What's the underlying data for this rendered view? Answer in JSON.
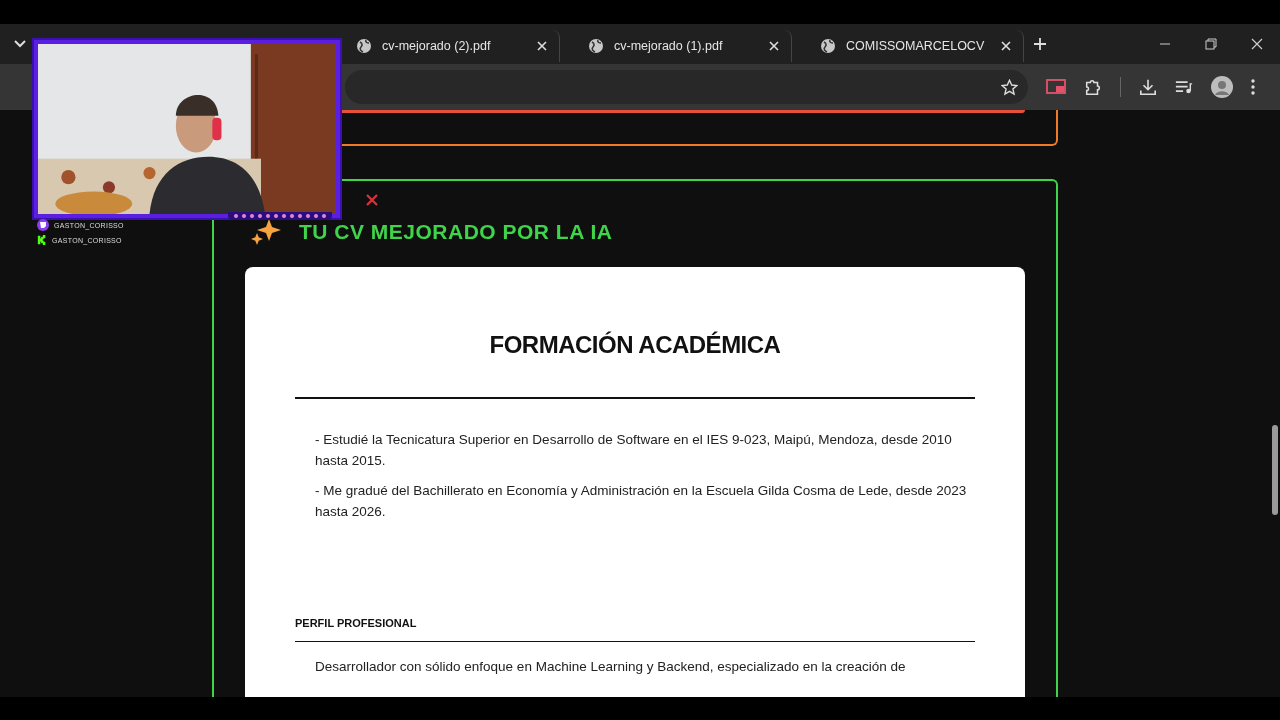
{
  "browser": {
    "tabs": [
      {
        "title": "cv-mejorado (2).pdf",
        "selected": false
      },
      {
        "title": "cv-mejorado (1).pdf",
        "selected": false
      },
      {
        "title": "COMISSOMARCELOCV",
        "selected": false
      }
    ]
  },
  "stream_overlay": {
    "usernames": [
      "GASTON_CORISSO",
      "GASTON_CORISSO"
    ]
  },
  "section": {
    "title": "TU CV MEJORADO POR LA IA"
  },
  "document": {
    "title": "FORMACIÓN ACADÉMICA",
    "paragraphs": [
      "- Estudié la Tecnicatura Superior en Desarrollo de Software en el IES 9-023, Maipú, Mendoza, desde 2010 hasta 2015.",
      "- Me gradué del Bachillerato en Economía y Administración en la Escuela Gilda Cosma de Lede, desde 2023 hasta 2026."
    ],
    "subheading": "PERFIL PROFESIONAL",
    "profile_text": "Desarrollador con sólido enfoque en Machine Learning y Backend, especializado en la creación de"
  }
}
